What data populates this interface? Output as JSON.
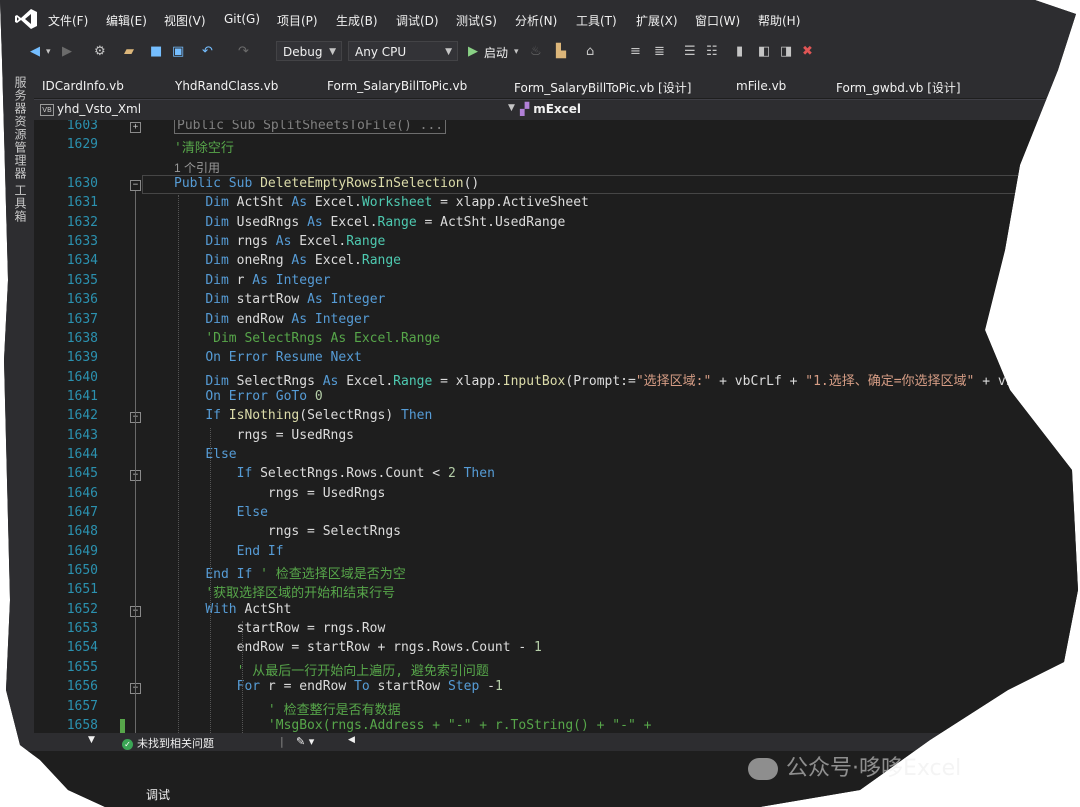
{
  "menu": [
    "文件(F)",
    "编辑(E)",
    "视图(V)",
    "Git(G)",
    "项目(P)",
    "生成(B)",
    "调试(D)",
    "测试(S)",
    "分析(N)",
    "工具(T)",
    "扩展(X)",
    "窗口(W)",
    "帮助(H)"
  ],
  "toolbar": {
    "config": "Debug",
    "platform": "Any CPU",
    "start": "启动"
  },
  "left_strip": [
    "服务器资源管理器",
    "工具箱"
  ],
  "tabs": [
    "IDCardInfo.vb",
    "YhdRandClass.vb",
    "Form_SalaryBillToPic.vb",
    "Form_SalaryBillToPic.vb [设计]",
    "mFile.vb",
    "Form_gwbd.vb [设计]"
  ],
  "navbar": {
    "project": "yhd_Vsto_Xml",
    "member": "mExcel"
  },
  "code_lines": [
    {
      "n": "1603",
      "html": "<span class='collapsed-box'>Public Sub SplitSheetsToFile() ...</span>"
    },
    {
      "n": "1629",
      "html": "<span class='cm'>'清除空行</span>"
    },
    {
      "n": "",
      "refs": "1 个引用"
    },
    {
      "n": "1630",
      "html": "<span class='kw'>Public Sub</span> <span class='fn'>DeleteEmptyRowsInSelection</span>()"
    },
    {
      "n": "1631",
      "html": "    <span class='kw'>Dim</span> ActSht <span class='kw'>As</span> Excel.<span class='ty'>Worksheet</span> = xlapp.ActiveSheet"
    },
    {
      "n": "1632",
      "html": "    <span class='kw'>Dim</span> UsedRngs <span class='kw'>As</span> Excel.<span class='ty'>Range</span> = ActSht.UsedRange"
    },
    {
      "n": "1633",
      "html": "    <span class='kw'>Dim</span> rngs <span class='kw'>As</span> Excel.<span class='ty'>Range</span>"
    },
    {
      "n": "1634",
      "html": "    <span class='kw'>Dim</span> oneRng <span class='kw'>As</span> Excel.<span class='ty'>Range</span>"
    },
    {
      "n": "1635",
      "html": "    <span class='kw'>Dim</span> r <span class='kw'>As</span> <span class='kw'>Integer</span>"
    },
    {
      "n": "1636",
      "html": "    <span class='kw'>Dim</span> startRow <span class='kw'>As</span> <span class='kw'>Integer</span>"
    },
    {
      "n": "1637",
      "html": "    <span class='kw'>Dim</span> endRow <span class='kw'>As</span> <span class='kw'>Integer</span>"
    },
    {
      "n": "1638",
      "html": "    <span class='cm'>'Dim SelectRngs As Excel.Range</span>"
    },
    {
      "n": "1639",
      "html": "    <span class='kw'>On Error Resume Next</span>"
    },
    {
      "n": "1640",
      "html": "    <span class='kw'>Dim</span> SelectRngs <span class='kw'>As</span> Excel.<span class='ty'>Range</span> = xlapp.<span class='fn'>InputBox</span>(Prompt:=<span class='st'>\"选择区域:\"</span> + vbCrLf + <span class='st'>\"1.选择、确定=你选择区域\"</span> + vb"
    },
    {
      "n": "1641",
      "html": "    <span class='kw'>On Error GoTo</span> <span class='nu'>0</span>"
    },
    {
      "n": "1642",
      "html": "    <span class='kw'>If</span> <span class='fn'>IsNothing</span>(SelectRngs) <span class='kw'>Then</span>"
    },
    {
      "n": "1643",
      "html": "        rngs = UsedRngs"
    },
    {
      "n": "1644",
      "html": "    <span class='kw'>Else</span>"
    },
    {
      "n": "1645",
      "html": "        <span class='kw'>If</span> SelectRngs.Rows.Count &lt; <span class='nu'>2</span> <span class='kw'>Then</span>"
    },
    {
      "n": "1646",
      "html": "            rngs = UsedRngs"
    },
    {
      "n": "1647",
      "html": "        <span class='kw'>Else</span>"
    },
    {
      "n": "1648",
      "html": "            rngs = SelectRngs"
    },
    {
      "n": "1649",
      "html": "        <span class='kw'>End If</span>"
    },
    {
      "n": "1650",
      "html": "    <span class='kw'>End If</span> <span class='cm'>' 检查选择区域是否为空</span>"
    },
    {
      "n": "1651",
      "html": "    <span class='cm'>'获取选择区域的开始和结束行号</span>"
    },
    {
      "n": "1652",
      "html": "    <span class='kw'>With</span> ActSht"
    },
    {
      "n": "1653",
      "html": "        startRow = rngs.Row"
    },
    {
      "n": "1654",
      "html": "        endRow = startRow + rngs.Rows.Count - <span class='nu'>1</span>"
    },
    {
      "n": "1655",
      "html": "        <span class='cm'>' 从最后一行开始向上遍历, 避免索引问题</span>"
    },
    {
      "n": "1656",
      "html": "        <span class='kw'>For</span> r = endRow <span class='kw'>To</span> startRow <span class='kw'>Step</span> -<span class='nu'>1</span>"
    },
    {
      "n": "1657",
      "html": "            <span class='cm'>' 检查整行是否有数据</span>"
    },
    {
      "n": "1658",
      "html": "            <span class='cm'>'MsgBox(rngs.Address + \"-\" + r.ToString() + \"-\" + </span>"
    }
  ],
  "status": {
    "issues": "未找到相关问题"
  },
  "bottom_tab": "调试",
  "watermark": "公众号·哆哆Excel",
  "colors": {
    "keyword": "#569cd6",
    "comment": "#57a64a",
    "type": "#4ec9b0",
    "string": "#d69d85",
    "line_number": "#2b91af",
    "chrome": "#2d2d30",
    "editor_bg": "#1e1e1e"
  }
}
